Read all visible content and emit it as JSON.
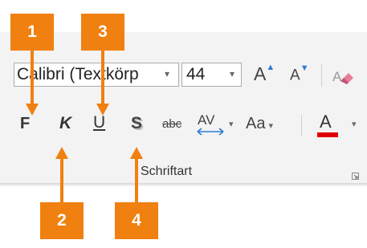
{
  "font_group": {
    "font_name": "Calibri (Textkörp",
    "font_size": "44",
    "grow_label": "A",
    "shrink_label": "A",
    "bold_label": "F",
    "italic_label": "K",
    "underline_label": "U",
    "shadow_label": "S",
    "strike_label": "abc",
    "spacing_label": "AV",
    "case_label": "Aa",
    "color_label": "A",
    "group_label": "Schriftart",
    "font_color_hex": "#e00000"
  },
  "callouts": {
    "n1": "1",
    "n2": "2",
    "n3": "3",
    "n4": "4",
    "color": "#f08010"
  },
  "icons": [
    "dropdown-arrow-icon",
    "grow-font-icon",
    "shrink-font-icon",
    "clear-formatting-icon",
    "dialog-launcher-icon",
    "arrow-icon"
  ]
}
